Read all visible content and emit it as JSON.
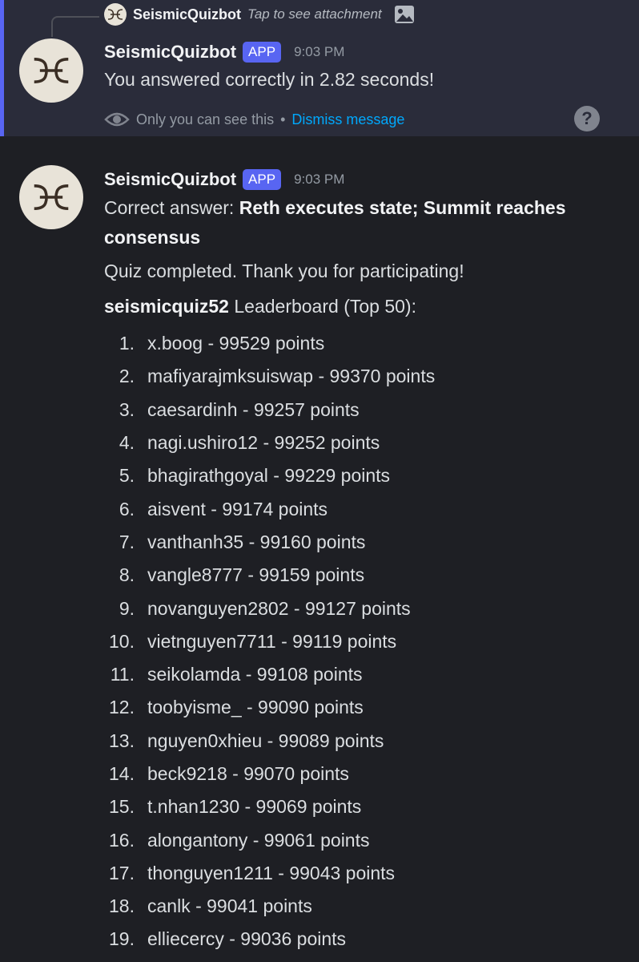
{
  "reply": {
    "username": "SeismicQuizbot",
    "text": "Tap to see attachment",
    "icon": "image-icon"
  },
  "ephemeral_message": {
    "username": "SeismicQuizbot",
    "badge": "APP",
    "time": "9:03 PM",
    "text": "You answered correctly in 2.82 seconds!",
    "visibility_text": "Only you can see this",
    "separator": "•",
    "dismiss_label": "Dismiss message",
    "help_label": "?"
  },
  "main_message": {
    "username": "SeismicQuizbot",
    "badge": "APP",
    "time": "9:03 PM",
    "answer_prefix": "Correct answer: ",
    "answer_line1": "Reth executes state; Summit reaches",
    "answer_line2": "consensus",
    "completion_text": "Quiz completed. Thank you for participating!",
    "leaderboard_name": "seismicquiz52",
    "leaderboard_title": " Leaderboard (Top 50):",
    "leaderboard": [
      {
        "rank": "1.",
        "entry": "x.boog - 99529 points"
      },
      {
        "rank": "2.",
        "entry": "mafiyarajmksuiswap - 99370 points"
      },
      {
        "rank": "3.",
        "entry": "caesardinh - 99257 points"
      },
      {
        "rank": "4.",
        "entry": "nagi.ushiro12 - 99252 points"
      },
      {
        "rank": "5.",
        "entry": "bhagirathgoyal - 99229 points"
      },
      {
        "rank": "6.",
        "entry": "aisvent - 99174 points"
      },
      {
        "rank": "7.",
        "entry": "vanthanh35 - 99160 points"
      },
      {
        "rank": "8.",
        "entry": "vangle8777 - 99159 points"
      },
      {
        "rank": "9.",
        "entry": "novanguyen2802 - 99127 points"
      },
      {
        "rank": "10.",
        "entry": "vietnguyen7711 - 99119 points"
      },
      {
        "rank": "11.",
        "entry": "seikolamda - 99108 points"
      },
      {
        "rank": "12.",
        "entry": "toobyisme_ - 99090 points"
      },
      {
        "rank": "13.",
        "entry": "nguyen0xhieu - 99089 points"
      },
      {
        "rank": "14.",
        "entry": "beck9218 - 99070 points"
      },
      {
        "rank": "15.",
        "entry": "t.nhan1230 - 99069 points"
      },
      {
        "rank": "16.",
        "entry": "alongantony - 99061 points"
      },
      {
        "rank": "17.",
        "entry": "thonguyen1211 - 99043 points"
      },
      {
        "rank": "18.",
        "entry": "canlk - 99041 points"
      },
      {
        "rank": "19.",
        "entry": "elliecercy - 99036 points"
      }
    ]
  },
  "colors": {
    "background": "#1e1f24",
    "ephemeral_background": "#2a2c3a",
    "accent": "#5865f2",
    "link": "#00a8fc",
    "muted": "#949ba4"
  }
}
